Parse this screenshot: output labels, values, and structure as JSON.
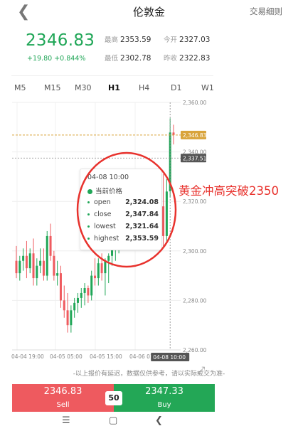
{
  "header": {
    "back_icon": "chevron-left-icon",
    "title": "伦敦金",
    "detail": "交易细则"
  },
  "quote": {
    "price": "2346.83",
    "change": "+19.80",
    "change_pct": "+0.844%",
    "high_label": "最高",
    "high": "2353.59",
    "open_label": "今开",
    "open": "2327.03",
    "low_label": "最低",
    "low": "2302.78",
    "prev_label": "昨收",
    "prev": "2322.83"
  },
  "timeframes": [
    {
      "label": "M5"
    },
    {
      "label": "M15"
    },
    {
      "label": "M30"
    },
    {
      "label": "H1",
      "active": true
    },
    {
      "label": "H4"
    },
    {
      "label": "D1"
    },
    {
      "label": "W1"
    }
  ],
  "chart_data": {
    "type": "candlestick",
    "y_ticks": [
      "2,360.00",
      "2,340.00",
      "2,320.00",
      "2,300.00",
      "2,280.00",
      "2,260.00"
    ],
    "ylim": [
      2260,
      2360
    ],
    "x_ticks": [
      "04-04 19:00",
      "04-05 05:00",
      "04-05 15:00",
      "04-06 01:00"
    ],
    "cursor_time": "04-08 10:00",
    "current_price_tag": "2,346.83",
    "cursor_price_tag": "2,337.51",
    "current_price": 2346.83,
    "cursor_price": 2337.51,
    "colors": {
      "up": "#20a657",
      "down": "#ef5b5f",
      "price_line": "#d9a43b"
    },
    "candles": [
      {
        "o": 2296.0,
        "h": 2302.0,
        "l": 2289.0,
        "c": 2291.0
      },
      {
        "o": 2291.0,
        "h": 2298.0,
        "l": 2288.0,
        "c": 2296.0
      },
      {
        "o": 2296.0,
        "h": 2301.0,
        "l": 2292.0,
        "c": 2298.0
      },
      {
        "o": 2298.0,
        "h": 2304.0,
        "l": 2289.0,
        "c": 2293.0
      },
      {
        "o": 2293.0,
        "h": 2301.0,
        "l": 2291.0,
        "c": 2299.0
      },
      {
        "o": 2299.0,
        "h": 2305.0,
        "l": 2286.0,
        "c": 2289.0
      },
      {
        "o": 2289.0,
        "h": 2297.0,
        "l": 2286.0,
        "c": 2294.0
      },
      {
        "o": 2294.0,
        "h": 2301.0,
        "l": 2291.0,
        "c": 2296.0
      },
      {
        "o": 2296.0,
        "h": 2301.0,
        "l": 2288.0,
        "c": 2290.0
      },
      {
        "o": 2290.0,
        "h": 2308.0,
        "l": 2288.0,
        "c": 2306.0
      },
      {
        "o": 2306.0,
        "h": 2311.0,
        "l": 2296.0,
        "c": 2298.0
      },
      {
        "o": 2298.0,
        "h": 2300.0,
        "l": 2288.0,
        "c": 2290.0
      },
      {
        "o": 2290.0,
        "h": 2296.0,
        "l": 2286.0,
        "c": 2291.0
      },
      {
        "o": 2291.0,
        "h": 2294.0,
        "l": 2277.0,
        "c": 2280.0
      },
      {
        "o": 2280.0,
        "h": 2286.0,
        "l": 2273.0,
        "c": 2276.0
      },
      {
        "o": 2276.0,
        "h": 2283.0,
        "l": 2267.0,
        "c": 2270.0
      },
      {
        "o": 2270.0,
        "h": 2278.0,
        "l": 2267.0,
        "c": 2276.0
      },
      {
        "o": 2276.0,
        "h": 2281.0,
        "l": 2273.0,
        "c": 2279.0
      },
      {
        "o": 2279.0,
        "h": 2283.0,
        "l": 2275.0,
        "c": 2281.0
      },
      {
        "o": 2281.0,
        "h": 2285.0,
        "l": 2277.0,
        "c": 2283.0
      },
      {
        "o": 2283.0,
        "h": 2287.0,
        "l": 2278.0,
        "c": 2285.0
      },
      {
        "o": 2285.0,
        "h": 2286.0,
        "l": 2279.0,
        "c": 2282.0
      },
      {
        "o": 2282.0,
        "h": 2292.0,
        "l": 2280.0,
        "c": 2290.0
      },
      {
        "o": 2290.0,
        "h": 2297.0,
        "l": 2286.0,
        "c": 2289.0
      },
      {
        "o": 2289.0,
        "h": 2297.0,
        "l": 2286.0,
        "c": 2295.0
      },
      {
        "o": 2295.0,
        "h": 2299.0,
        "l": 2288.0,
        "c": 2291.0
      },
      {
        "o": 2291.0,
        "h": 2297.0,
        "l": 2282.0,
        "c": 2296.0
      },
      {
        "o": 2296.0,
        "h": 2299.0,
        "l": 2287.0,
        "c": 2298.0
      },
      {
        "o": 2298.0,
        "h": 2305.0,
        "l": 2294.0,
        "c": 2301.0
      },
      {
        "o": 2301.0,
        "h": 2311.0,
        "l": 2296.0,
        "c": 2303.0
      },
      {
        "o": 2303.0,
        "h": 2313.0,
        "l": 2299.0,
        "c": 2307.0
      },
      {
        "o": 2307.0,
        "h": 2312.0,
        "l": 2303.0,
        "c": 2309.0
      },
      {
        "o": 2309.0,
        "h": 2315.0,
        "l": 2305.0,
        "c": 2311.0
      },
      {
        "o": 2311.0,
        "h": 2318.0,
        "l": 2309.0,
        "c": 2316.0
      },
      {
        "o": 2316.0,
        "h": 2319.0,
        "l": 2311.0,
        "c": 2314.0
      },
      {
        "o": 2314.0,
        "h": 2317.0,
        "l": 2309.0,
        "c": 2312.0
      },
      {
        "o": 2312.0,
        "h": 2318.0,
        "l": 2306.0,
        "c": 2316.0
      },
      {
        "o": 2316.0,
        "h": 2320.0,
        "l": 2311.0,
        "c": 2313.0
      },
      {
        "o": 2313.0,
        "h": 2318.0,
        "l": 2309.0,
        "c": 2316.0
      },
      {
        "o": 2316.0,
        "h": 2320.0,
        "l": 2304.0,
        "c": 2307.0
      },
      {
        "o": 2307.0,
        "h": 2313.0,
        "l": 2303.0,
        "c": 2311.0
      },
      {
        "o": 2311.0,
        "h": 2315.0,
        "l": 2307.0,
        "c": 2313.0
      },
      {
        "o": 2313.0,
        "h": 2321.0,
        "l": 2309.0,
        "c": 2318.0
      },
      {
        "o": 2318.0,
        "h": 2331.0,
        "l": 2302.0,
        "c": 2306.0
      },
      {
        "o": 2306.0,
        "h": 2329.0,
        "l": 2303.0,
        "c": 2324.0
      },
      {
        "o": 2324.08,
        "h": 2353.59,
        "l": 2321.64,
        "c": 2347.84
      },
      {
        "o": 2347.84,
        "h": 2351.0,
        "l": 2343.0,
        "c": 2346.83
      }
    ]
  },
  "tooltip": {
    "time": "04-08 10:00",
    "current_label": "当前价格",
    "rows": [
      {
        "label": "open",
        "value": "2,324.08"
      },
      {
        "label": "close",
        "value": "2,347.84"
      },
      {
        "label": "lowest",
        "value": "2,321.64"
      },
      {
        "label": "highest",
        "value": "2,353.59"
      }
    ]
  },
  "annotation": {
    "text": "黄金冲高突破2350",
    "color": "#e8322d"
  },
  "disclaimer": "-以上报价有延迟，数据仅供参考，请以实际成交为准-",
  "expand_icon": "expand-icon",
  "trade": {
    "sell_price": "2346.83",
    "sell_label": "Sell",
    "spread": "50",
    "buy_price": "2347.33",
    "buy_label": "Buy"
  },
  "nav": {
    "menu_icon": "menu-icon",
    "home_icon": "home-icon",
    "back_icon": "back-icon"
  }
}
